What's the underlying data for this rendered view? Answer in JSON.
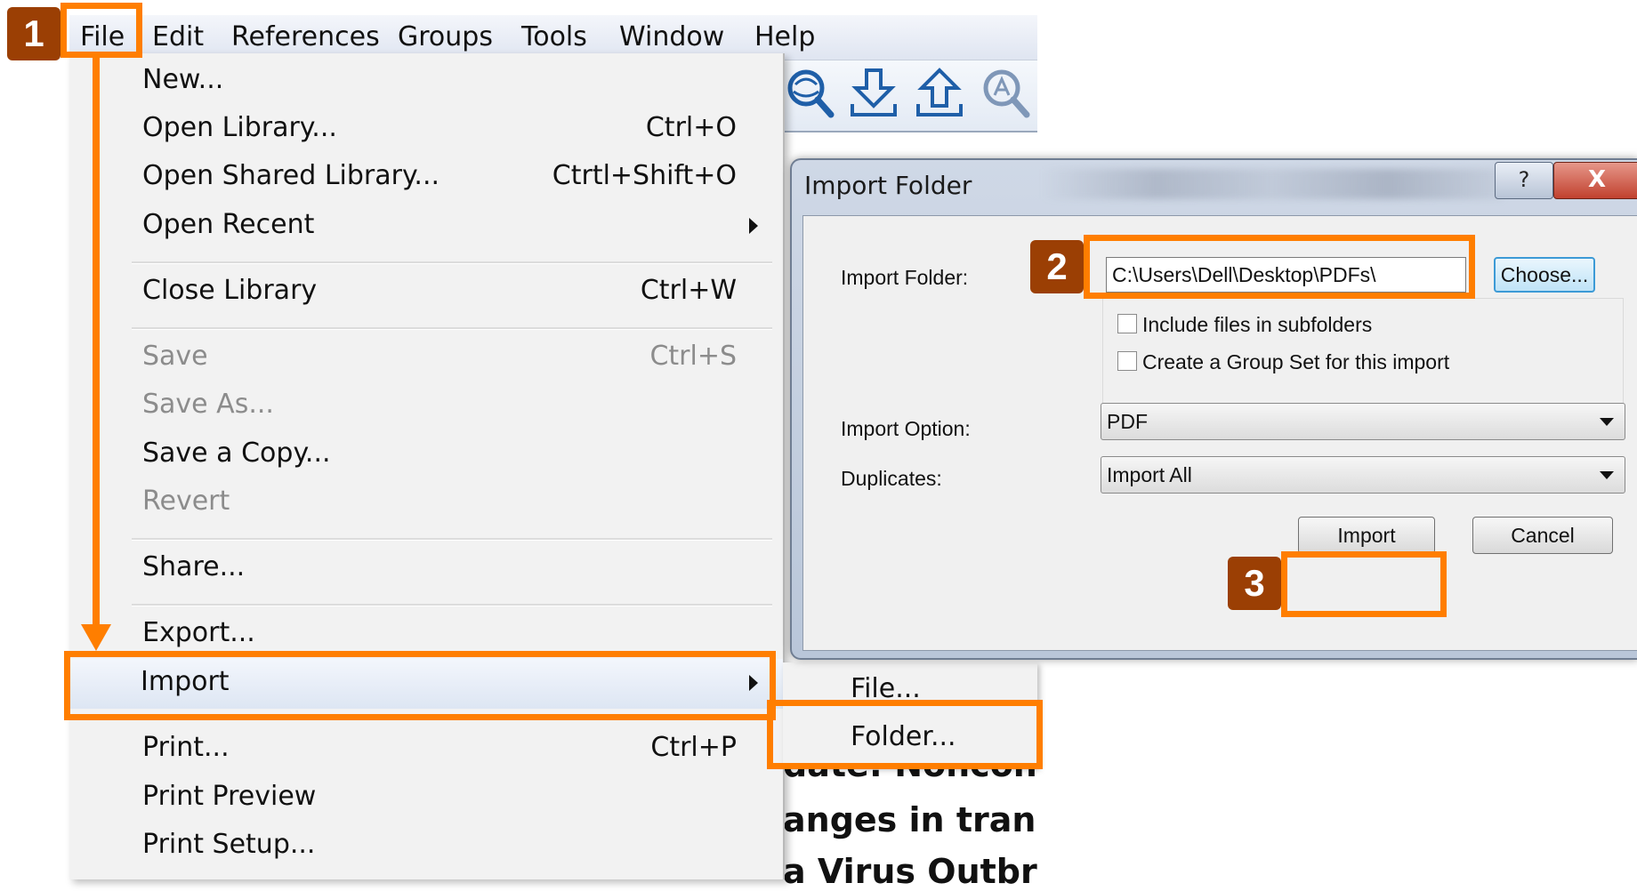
{
  "menubar": {
    "items": [
      "File",
      "Edit",
      "References",
      "Groups",
      "Tools",
      "Window",
      "Help"
    ]
  },
  "toolbar": {
    "icons": [
      "online-search-icon",
      "download-icon",
      "upload-icon",
      "pdf-search-icon"
    ]
  },
  "background_text": {
    "line1": "date: Noncong",
    "line2": "anges in transcr",
    "line3": "a Virus Outbrea"
  },
  "file_menu": {
    "new": "New...",
    "open_library": "Open Library...",
    "open_library_sc": "Ctrl+O",
    "open_shared": "Open Shared Library...",
    "open_shared_sc": "Ctrtl+Shift+O",
    "open_recent": "Open Recent",
    "close_library": "Close Library",
    "close_library_sc": "Ctrl+W",
    "save": "Save",
    "save_sc": "Ctrl+S",
    "save_as": "Save As...",
    "save_copy": "Save a Copy...",
    "revert": "Revert",
    "share": "Share...",
    "export": "Export...",
    "import": "Import",
    "print": "Print...",
    "print_sc": "Ctrl+P",
    "print_preview": "Print Preview",
    "print_setup": "Print Setup..."
  },
  "import_submenu": {
    "file": "File...",
    "folder": "Folder..."
  },
  "dialog": {
    "title": "Import Folder",
    "help_label": "?",
    "close_label": "X",
    "folder_label": "Import Folder:",
    "folder_path": "C:\\Users\\Dell\\Desktop\\PDFs\\",
    "choose_label": "Choose...",
    "include_subfolders": "Include files in subfolders",
    "create_group_set": "Create a Group Set for this import",
    "option_label": "Import Option:",
    "option_value": "PDF",
    "duplicates_label": "Duplicates:",
    "duplicates_value": "Import All",
    "import_button": "Import",
    "cancel_button": "Cancel"
  },
  "annotations": {
    "step1": "1",
    "step2": "2",
    "step3": "3",
    "color": "#ff7e00",
    "badge_color": "#9b3f04"
  }
}
